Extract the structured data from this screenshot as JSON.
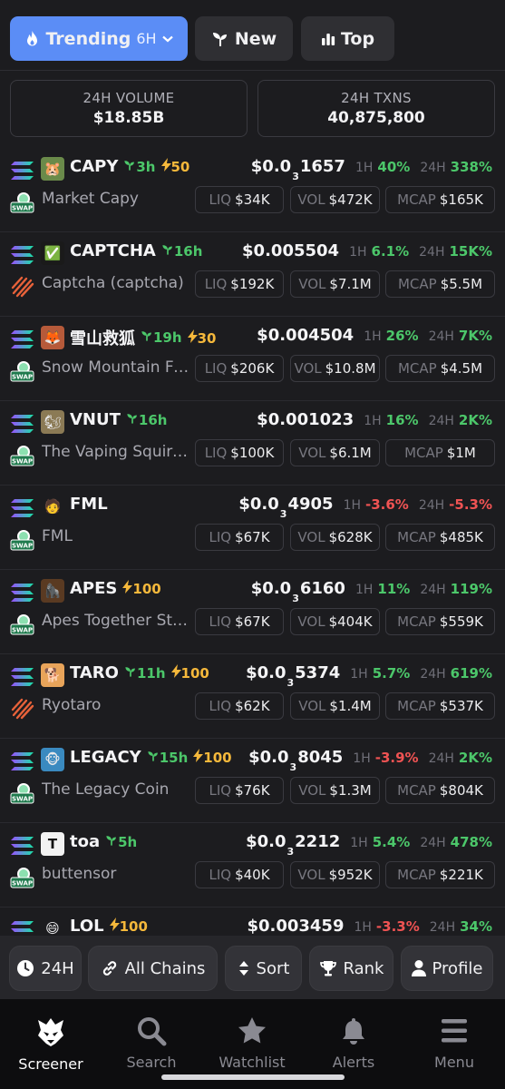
{
  "tabs": {
    "trending": {
      "label": "Trending",
      "sub": "6H"
    },
    "new": {
      "label": "New"
    },
    "top": {
      "label": "Top"
    }
  },
  "stats": {
    "volume": {
      "label": "24H VOLUME",
      "value": "$18.85B"
    },
    "txns": {
      "label": "24H TXNS",
      "value": "40,875,800"
    }
  },
  "tokens": [
    {
      "symbol": "CAPY",
      "age": "3h",
      "boost": "50",
      "name": "Market Capy",
      "p1": "$0.0",
      "psub": "3",
      "p2": "1657",
      "h1": "40%",
      "h1neg": false,
      "h24": "338%",
      "h24neg": false,
      "liq": "$34K",
      "vol": "$472K",
      "mcap": "$165K",
      "dex": "swap",
      "avatar": "🐹",
      "avbg": "#6a8a4a"
    },
    {
      "symbol": "CAPTCHA",
      "age": "16h",
      "boost": "",
      "name": "Captcha (captcha)",
      "p1": "$0.005504",
      "psub": "",
      "p2": "",
      "h1": "6.1%",
      "h1neg": false,
      "h24": "15K%",
      "h24neg": false,
      "liq": "$192K",
      "vol": "$7.1M",
      "mcap": "$5.5M",
      "dex": "stripe",
      "avatar": "✅",
      "avbg": "#1a1a1a"
    },
    {
      "symbol": "雪山救狐",
      "age": "19h",
      "boost": "30",
      "name": "Snow Mountain Fox",
      "p1": "$0.004504",
      "psub": "",
      "p2": "",
      "h1": "26%",
      "h1neg": false,
      "h24": "7K%",
      "h24neg": false,
      "liq": "$206K",
      "vol": "$10.8M",
      "mcap": "$4.5M",
      "dex": "swap",
      "avatar": "🦊",
      "avbg": "#b65a3a"
    },
    {
      "symbol": "VNUT",
      "age": "16h",
      "boost": "",
      "name": "The Vaping Squirrel",
      "p1": "$0.001023",
      "psub": "",
      "p2": "",
      "h1": "16%",
      "h1neg": false,
      "h24": "2K%",
      "h24neg": false,
      "liq": "$100K",
      "vol": "$6.1M",
      "mcap": "$1M",
      "dex": "swap",
      "avatar": "🐿",
      "avbg": "#8b7a55"
    },
    {
      "symbol": "FML",
      "age": "",
      "boost": "",
      "name": "FML",
      "p1": "$0.0",
      "psub": "3",
      "p2": "4905",
      "h1": "-3.6%",
      "h1neg": true,
      "h24": "-5.3%",
      "h24neg": true,
      "liq": "$67K",
      "vol": "$628K",
      "mcap": "$485K",
      "dex": "swap",
      "avatar": "🧑",
      "avbg": "transparent"
    },
    {
      "symbol": "APES",
      "age": "",
      "boost": "100",
      "name": "Apes Together Strong",
      "p1": "$0.0",
      "psub": "3",
      "p2": "6160",
      "h1": "11%",
      "h1neg": false,
      "h24": "119%",
      "h24neg": false,
      "liq": "$67K",
      "vol": "$404K",
      "mcap": "$559K",
      "dex": "swap",
      "avatar": "🦍",
      "avbg": "#5a3a22"
    },
    {
      "symbol": "TARO",
      "age": "11h",
      "boost": "100",
      "name": "Ryotaro",
      "p1": "$0.0",
      "psub": "3",
      "p2": "5374",
      "h1": "5.7%",
      "h1neg": false,
      "h24": "619%",
      "h24neg": false,
      "liq": "$62K",
      "vol": "$1.4M",
      "mcap": "$537K",
      "dex": "stripe",
      "avatar": "🐕",
      "avbg": "#e8a45a"
    },
    {
      "symbol": "LEGACY",
      "age": "15h",
      "boost": "100",
      "name": "The Legacy Coin",
      "p1": "$0.0",
      "psub": "3",
      "p2": "8045",
      "h1": "-3.9%",
      "h1neg": true,
      "h24": "2K%",
      "h24neg": false,
      "liq": "$76K",
      "vol": "$1.3M",
      "mcap": "$804K",
      "dex": "swap",
      "avatar": "🐵",
      "avbg": "#3a8ac0"
    },
    {
      "symbol": "toa",
      "age": "5h",
      "boost": "",
      "name": "buttensor",
      "p1": "$0.0",
      "psub": "3",
      "p2": "2212",
      "h1": "5.4%",
      "h1neg": false,
      "h24": "478%",
      "h24neg": false,
      "liq": "$40K",
      "vol": "$952K",
      "mcap": "$221K",
      "dex": "swap",
      "avatar": "T",
      "avbg": "#f2f2f2"
    },
    {
      "symbol": "LOL",
      "age": "",
      "boost": "100",
      "name": "",
      "p1": "$0.003459",
      "psub": "",
      "p2": "",
      "h1": "-3.3%",
      "h1neg": true,
      "h24": "34%",
      "h24neg": false,
      "liq": "",
      "vol": "",
      "mcap": "",
      "dex": "swap",
      "avatar": "😄",
      "avbg": "transparent"
    }
  ],
  "labels": {
    "tf1": "1H",
    "tf24": "24H",
    "liq": "LIQ",
    "vol": "VOL",
    "mcap": "MCAP",
    "swap": "SWAP"
  },
  "filters": {
    "time": "24H",
    "chains": "All Chains",
    "sort": "Sort",
    "rank": "Rank",
    "profile": "Profile"
  },
  "nav": {
    "screener": "Screener",
    "search": "Search",
    "watchlist": "Watchlist",
    "alerts": "Alerts",
    "menu": "Menu"
  },
  "colors": {
    "accent": "#5b8df6",
    "positive": "#4cc76a",
    "negative": "#ef5353",
    "boost": "#f5b83b"
  }
}
